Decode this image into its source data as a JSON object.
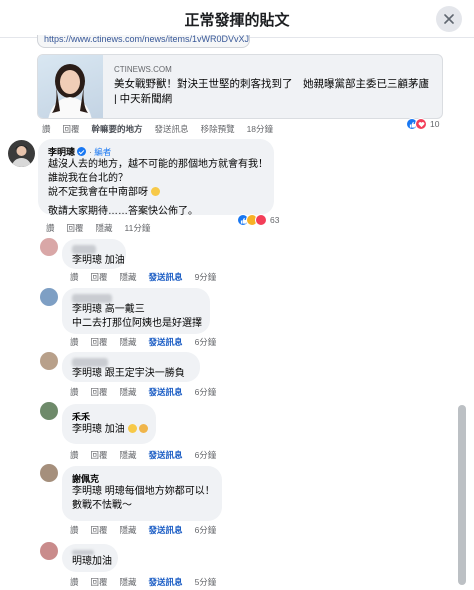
{
  "dialog": {
    "title": "正常發揮的貼文"
  },
  "link": {
    "url": "https://www.ctinews.com/news/items/1vWR0DVvXJ"
  },
  "preview": {
    "site": "CTINEWS.COM",
    "headline": "美女戰野獸！對決王世堅的刺客找到了　她親曝黨部主委已三顧茅廬 | 中天新聞網"
  },
  "post_actions": {
    "like": "讚",
    "reply": "回覆",
    "hide": "幹嘛要的地方",
    "share": "發送訊息",
    "more": "移除預覽",
    "time": "18分鐘",
    "reaction_count": "10"
  },
  "comments": [
    {
      "name": "李明璁",
      "badge": "編者",
      "lines": [
        "越沒人去的地方，越不可能的那個地方就會有我！",
        "誰說我在台北的？",
        "說不定我會在中南部呀",
        "",
        "敬請大家期待……答案快公佈了。"
      ],
      "actions": {
        "like": "讚",
        "reply": "回覆",
        "hide": "隱藏",
        "time": "11分鐘"
      },
      "reaction_count": "63"
    },
    {
      "name": "",
      "lines": [
        "李明璁 加油"
      ],
      "actions": {
        "like": "讚",
        "reply": "回覆",
        "hide": "隱藏",
        "message": "發送訊息",
        "time": "9分鐘"
      }
    },
    {
      "name": "",
      "lines": [
        "李明璁 高一戴三",
        "中二去打那位阿姨也是好選擇"
      ],
      "actions": {
        "like": "讚",
        "reply": "回覆",
        "hide": "隱藏",
        "message": "發送訊息",
        "time": "6分鐘"
      }
    },
    {
      "name": "",
      "lines": [
        "李明璁 跟王定宇決一勝負"
      ],
      "actions": {
        "like": "讚",
        "reply": "回覆",
        "hide": "隱藏",
        "message": "發送訊息",
        "time": "6分鐘"
      }
    },
    {
      "name": "禾禾",
      "lines": [
        "李明璁 加油"
      ],
      "actions": {
        "like": "讚",
        "reply": "回覆",
        "hide": "隱藏",
        "message": "發送訊息",
        "time": "6分鐘"
      }
    },
    {
      "name": "謝佩克",
      "lines": [
        "李明璁 明璁每個地方妳都可以！",
        "數戰不怯戰～"
      ],
      "actions": {
        "like": "讚",
        "reply": "回覆",
        "hide": "隱藏",
        "message": "發送訊息",
        "time": "6分鐘"
      }
    },
    {
      "name": "",
      "lines": [
        "明璁加油"
      ],
      "actions": {
        "like": "讚",
        "reply": "回覆",
        "hide": "隱藏",
        "message": "發送訊息",
        "time": "5分鐘"
      }
    }
  ]
}
